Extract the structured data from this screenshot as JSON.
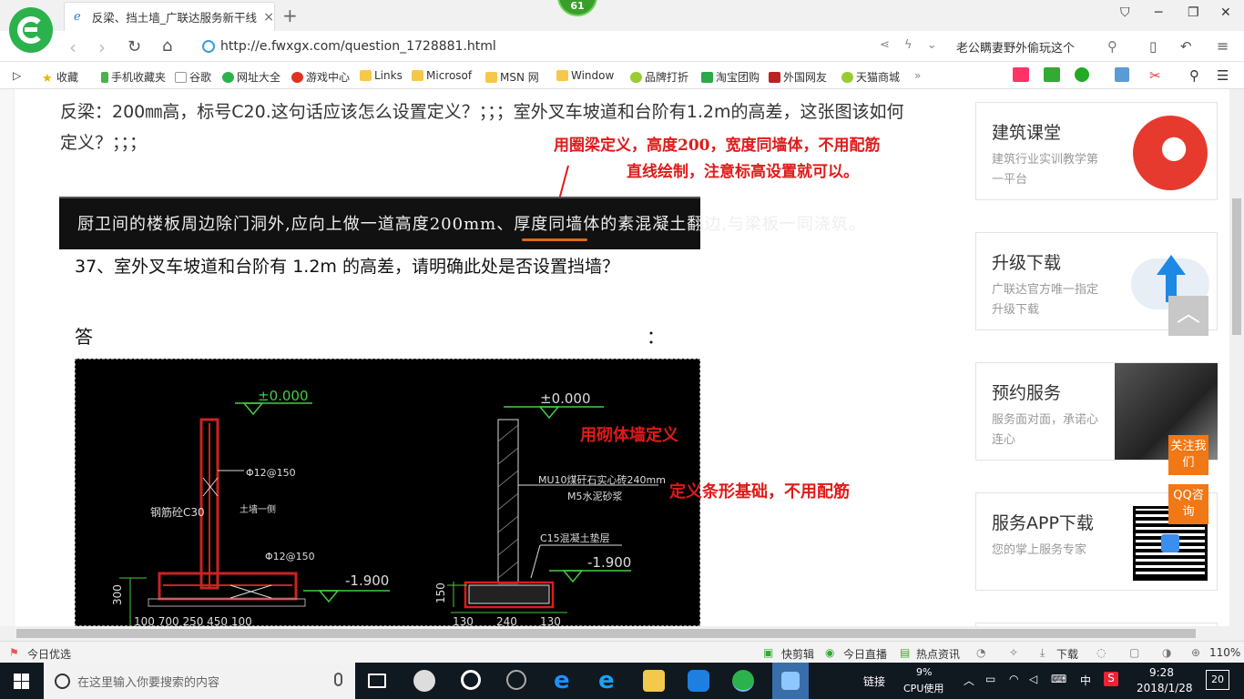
{
  "browser": {
    "tab_title": "反梁、挡土墙_广联达服务新干线",
    "tab_close": "×",
    "new_tab": "+",
    "badge_count": "61",
    "url": "http://e.fwxgx.com/question_1728881.html",
    "hot_search": "老公瞒妻野外偷玩这个"
  },
  "bookmarks": [
    "收藏",
    "手机收藏夹",
    "谷歌",
    "网址大全",
    "游戏中心",
    "Links",
    "Microsof",
    "MSN 网",
    "Window",
    "品牌打折",
    "淘宝团购",
    "外国网友",
    "天猫商城"
  ],
  "article": {
    "question_1": "反梁：200㎜高，标号C20.这句话应该怎么设置定义？；；；室外叉车坡道和台阶有1.2m的高差，这张图该如何定义？；；；",
    "annotation_top_line1": "用圈梁定义，高度200，宽度同墙体，不用配筋",
    "annotation_top_line2": "直线绘制，注意标高设置就可以。",
    "strip_text": "厨卫间的楼板周边除门洞外,应向上做一道高度200mm、厚度同墙体的素混凝土翻边,与梁板一同浇筑。",
    "question_37": "37、室外叉车坡道和台阶有 1.2m 的高差，请明确此处是否设置挡墙？",
    "answer_label": "答",
    "answer_colon": "：",
    "annotation_wall": "用砌体墙定义",
    "annotation_footing": "定义条形基础，不用配筋"
  },
  "cad": {
    "level_left": "±0.000",
    "level_right": "±0.000",
    "rebar_top": "Φ12@150",
    "rebar_bottom": "Φ12@150",
    "concrete": "钢筋砼C30",
    "retaining_label": "土墙一侧",
    "wall_spec_1": "MU10煤矸石实心砖240mm",
    "wall_spec_2": "M5水泥砂浆",
    "cushion": "C15混凝土垫层",
    "depth_left": "-1.900",
    "depth_right": "-1.900",
    "dim_150": "150",
    "dim_300": "300",
    "dim_bottom_left": "100  700  250    450     100",
    "dim_130a": "130",
    "dim_240": "240",
    "dim_130b": "130"
  },
  "sidebar": [
    {
      "title": "建筑课堂",
      "subtitle": "建筑行业实训教学第一平台"
    },
    {
      "title": "升级下载",
      "subtitle": "广联达官方唯一指定升级下载"
    },
    {
      "title": "预约服务",
      "subtitle": "服务面对面，承诺心连心"
    },
    {
      "title": "服务APP下载",
      "subtitle": "您的掌上服务专家"
    }
  ],
  "float": {
    "follow": "关注我们",
    "qq": "QQ咨询"
  },
  "statusbar": {
    "left": "今日优选",
    "items": [
      "快剪辑",
      "今日直播",
      "热点资讯",
      "下载"
    ],
    "zoom": "110%"
  },
  "taskbar": {
    "search_placeholder": "在这里输入你要搜索的内容",
    "link_label": "链接",
    "cpu_percent": "9%",
    "cpu_label": "CPU使用",
    "ime": "中",
    "time": "9:28",
    "date": "2018/1/28",
    "notifications": "20"
  },
  "colors": {
    "annotation_red": "#e01a1a",
    "brand_green": "#2bb24c",
    "float_orange": "#f07816"
  }
}
